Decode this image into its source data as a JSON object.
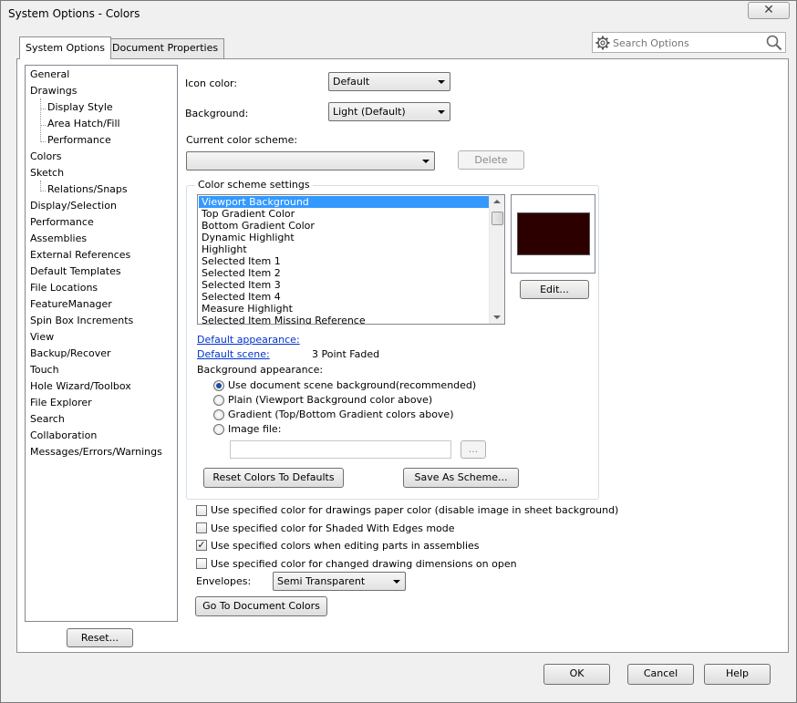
{
  "window": {
    "title": "System Options - Colors",
    "close_glyph": "✕"
  },
  "tabs": [
    {
      "label": "System Options",
      "active": true
    },
    {
      "label": "Document Properties",
      "active": false
    }
  ],
  "search": {
    "placeholder": "Search Options",
    "icon_left": "gear-icon",
    "icon_right": "magnifier-icon"
  },
  "sidebar": {
    "items": [
      {
        "label": "General",
        "level": 0
      },
      {
        "label": "Drawings",
        "level": 0
      },
      {
        "label": "Display Style",
        "level": 1
      },
      {
        "label": "Area Hatch/Fill",
        "level": 1
      },
      {
        "label": "Performance",
        "level": 1
      },
      {
        "label": "Colors",
        "level": 0
      },
      {
        "label": "Sketch",
        "level": 0
      },
      {
        "label": "Relations/Snaps",
        "level": 1
      },
      {
        "label": "Display/Selection",
        "level": 0
      },
      {
        "label": "Performance",
        "level": 0
      },
      {
        "label": "Assemblies",
        "level": 0
      },
      {
        "label": "External References",
        "level": 0
      },
      {
        "label": "Default Templates",
        "level": 0
      },
      {
        "label": "File Locations",
        "level": 0
      },
      {
        "label": "FeatureManager",
        "level": 0
      },
      {
        "label": "Spin Box Increments",
        "level": 0
      },
      {
        "label": "View",
        "level": 0
      },
      {
        "label": "Backup/Recover",
        "level": 0
      },
      {
        "label": "Touch",
        "level": 0
      },
      {
        "label": "Hole Wizard/Toolbox",
        "level": 0
      },
      {
        "label": "File Explorer",
        "level": 0
      },
      {
        "label": "Search",
        "level": 0
      },
      {
        "label": "Collaboration",
        "level": 0
      },
      {
        "label": "Messages/Errors/Warnings",
        "level": 0
      }
    ],
    "reset_label": "Reset..."
  },
  "main": {
    "icon_color_label": "Icon color:",
    "icon_color_value": "Default",
    "background_label": "Background:",
    "background_value": "Light (Default)",
    "scheme_label": "Current color scheme:",
    "scheme_value": "",
    "delete_label": "Delete",
    "group_title": "Color scheme settings",
    "color_items": [
      "Viewport Background",
      "Top Gradient Color",
      "Bottom Gradient Color",
      "Dynamic Highlight",
      "Highlight",
      "Selected Item 1",
      "Selected Item 2",
      "Selected Item 3",
      "Selected Item 4",
      "Measure Highlight",
      "Selected Item Missing Reference"
    ],
    "swatch_color": "#2d0000",
    "edit_label": "Edit...",
    "default_appearance_label": "Default appearance:",
    "default_scene_label": "Default scene:",
    "default_scene_value": "3 Point Faded",
    "bg_appearance_label": "Background appearance:",
    "radios": [
      {
        "label": "Use document scene background(recommended)",
        "checked": true
      },
      {
        "label": "Plain (Viewport Background color above)",
        "checked": false
      },
      {
        "label": "Gradient (Top/Bottom Gradient colors above)",
        "checked": false
      },
      {
        "label": "Image file:",
        "checked": false
      }
    ],
    "image_file_value": "",
    "browse_label": "...",
    "reset_colors_label": "Reset Colors To Defaults",
    "save_scheme_label": "Save As Scheme...",
    "checkboxes": [
      {
        "label": "Use specified color for drawings paper color (disable image in sheet background)",
        "checked": false
      },
      {
        "label": "Use specified color for Shaded With Edges mode",
        "checked": false
      },
      {
        "label": "Use specified colors when editing parts in assemblies",
        "checked": true
      },
      {
        "label": "Use specified color for changed drawing dimensions on open",
        "checked": false
      }
    ],
    "check_glyph": "✓",
    "envelopes_label": "Envelopes:",
    "envelopes_value": "Semi Transparent",
    "go_doc_colors_label": "Go To Document Colors"
  },
  "footer": {
    "ok_label": "OK",
    "cancel_label": "Cancel",
    "help_label": "Help"
  }
}
